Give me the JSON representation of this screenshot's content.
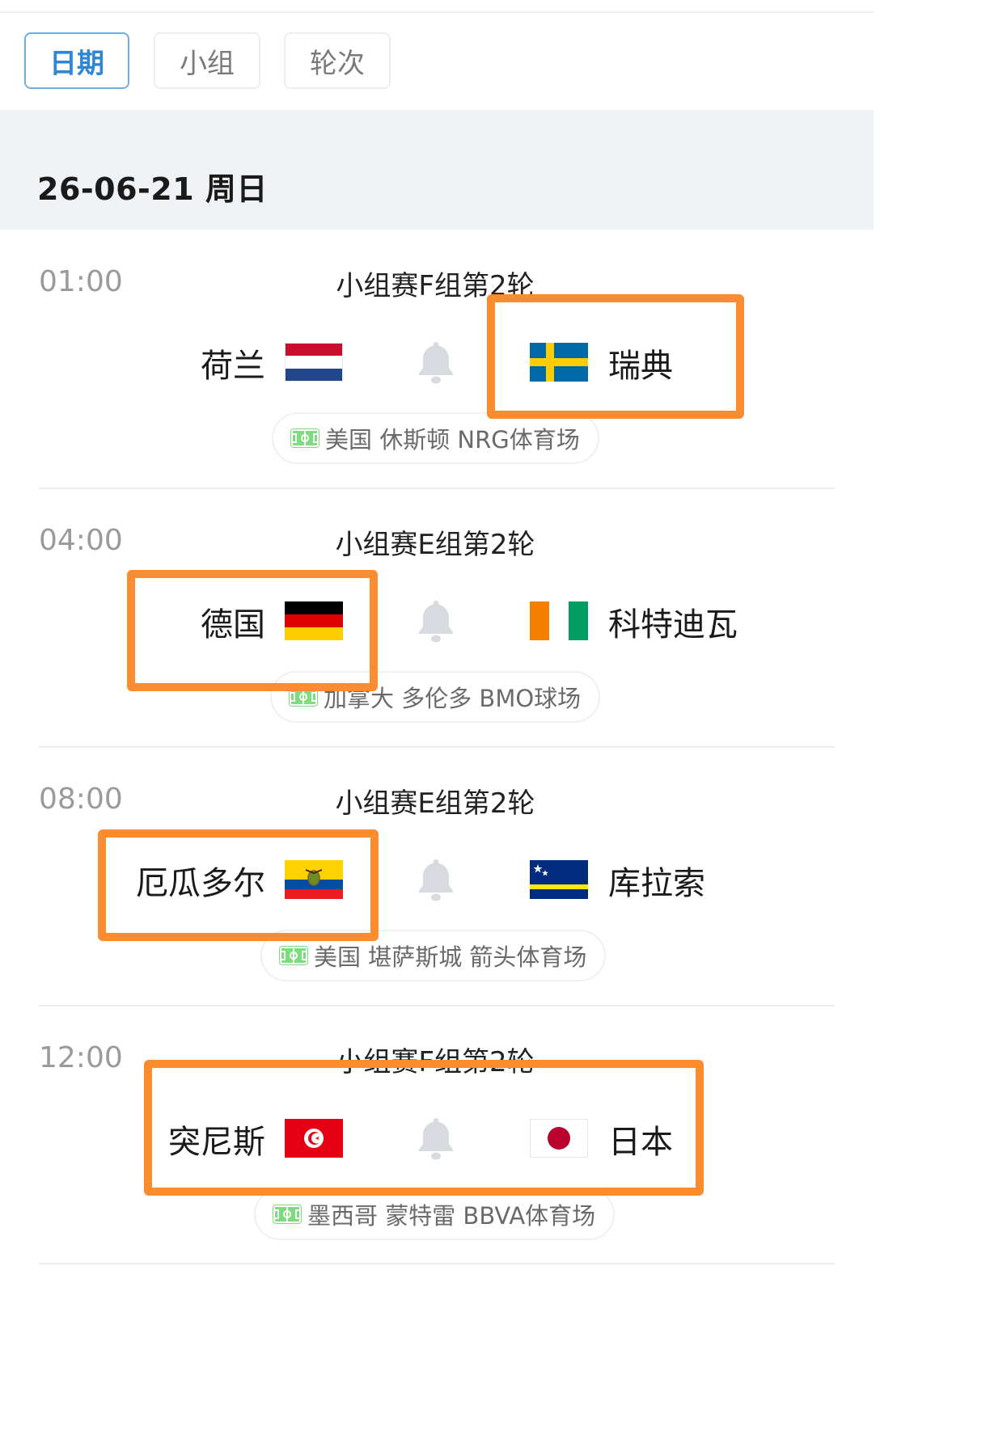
{
  "tabs": [
    {
      "label": "日期",
      "active": true
    },
    {
      "label": "小组",
      "active": false
    },
    {
      "label": "轮次",
      "active": false
    }
  ],
  "date_header": "26-06-21 周日",
  "matches": [
    {
      "time": "01:00",
      "stage": "小组赛F组第2轮",
      "home": "荷兰",
      "home_flag": "netherlands-flag",
      "away": "瑞典",
      "away_flag": "sweden-flag",
      "venue": "美国 休斯顿 NRG体育场"
    },
    {
      "time": "04:00",
      "stage": "小组赛E组第2轮",
      "home": "德国",
      "home_flag": "germany-flag",
      "away": "科特迪瓦",
      "away_flag": "ivory-coast-flag",
      "venue": "加拿大 多伦多 BMO球场"
    },
    {
      "time": "08:00",
      "stage": "小组赛E组第2轮",
      "home": "厄瓜多尔",
      "home_flag": "ecuador-flag",
      "away": "库拉索",
      "away_flag": "curacao-flag",
      "venue": "美国 堪萨斯城 箭头体育场"
    },
    {
      "time": "12:00",
      "stage": "小组赛F组第2轮",
      "home": "突尼斯",
      "home_flag": "tunisia-flag",
      "away": "日本",
      "away_flag": "japan-flag",
      "venue": "墨西哥 蒙特雷 BBVA体育场"
    }
  ],
  "icons": {
    "bell": "bell-icon",
    "venue": "football-pitch-icon"
  },
  "colors": {
    "accent": "#2e86d4",
    "highlight": "#fb8c2f",
    "header_bg": "#eff2f5",
    "pitch": "#6fd16f"
  }
}
